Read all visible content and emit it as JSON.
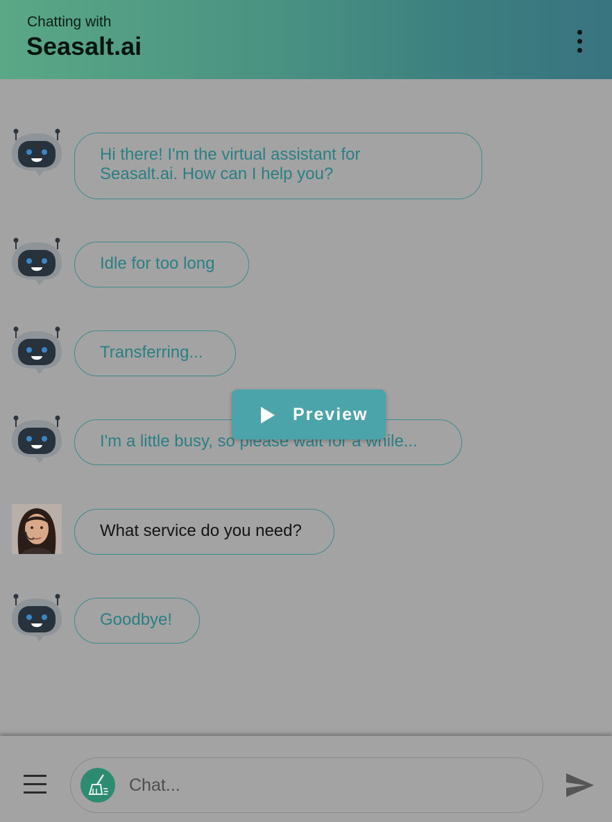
{
  "header": {
    "subtitle": "Chatting with",
    "title": "Seasalt.ai"
  },
  "messages": [
    {
      "sender": "bot",
      "text": "Hi there! I'm the virtual assistant for\nSeasalt.ai. How can I help you?"
    },
    {
      "sender": "bot",
      "text": "Idle for too long"
    },
    {
      "sender": "bot",
      "text": "Transferring..."
    },
    {
      "sender": "bot",
      "text": "I'm a little busy, so please wait for a while..."
    },
    {
      "sender": "agent",
      "text": "What service do you need?"
    },
    {
      "sender": "bot",
      "text": "Goodbye!"
    }
  ],
  "preview_button": {
    "label": "Preview"
  },
  "composer": {
    "placeholder": "Chat..."
  },
  "colors": {
    "header_gradient_start": "#5aa886",
    "header_gradient_end": "#397481",
    "bubble_border": "#3c8b8e",
    "bot_text": "#2b7f84",
    "preview_bg": "#4aa4a9",
    "overlay_bg": "#a3a3a3"
  }
}
